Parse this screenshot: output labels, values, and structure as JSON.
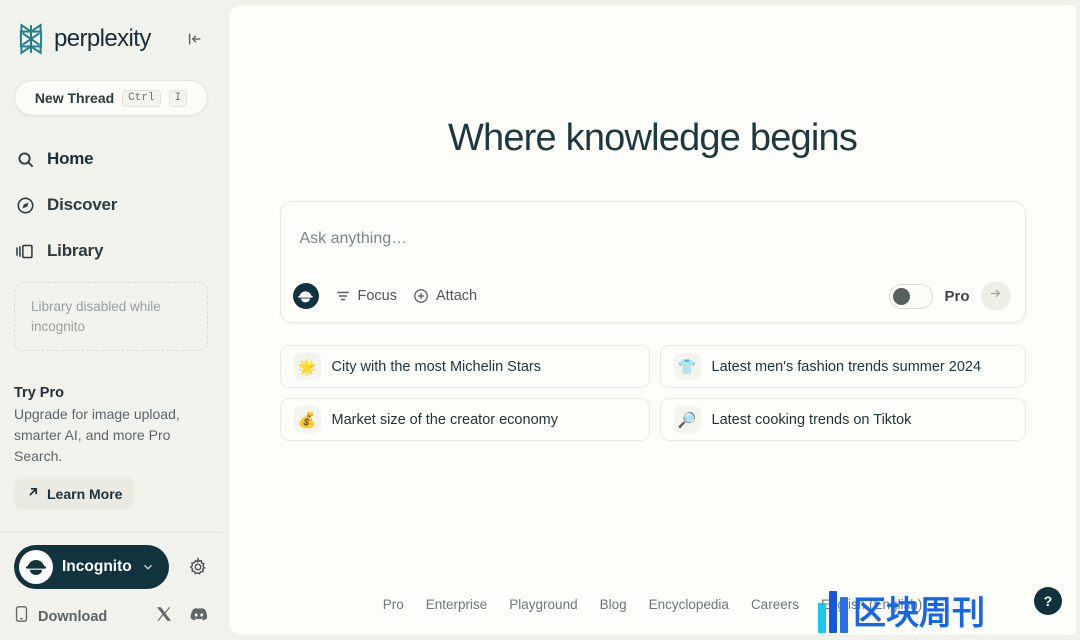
{
  "sidebar": {
    "brand": "perplexity",
    "collapse_icon": "collapse-left-icon",
    "new_thread": {
      "label": "New Thread",
      "key_mod": "Ctrl",
      "key_letter": "I"
    },
    "nav": [
      {
        "label": "Home",
        "icon": "search-icon",
        "active": true
      },
      {
        "label": "Discover",
        "icon": "compass-icon",
        "active": false
      },
      {
        "label": "Library",
        "icon": "library-icon",
        "active": false
      }
    ],
    "library_disabled_note": "Library disabled while incognito",
    "try_pro": {
      "title": "Try Pro",
      "body": "Upgrade for image upload, smarter AI, and more Pro Search.",
      "cta": "Learn More",
      "cta_icon": "arrow-up-right-icon"
    },
    "account": {
      "name": "Incognito",
      "avatar_icon": "incognito-hat-icon",
      "chevron_icon": "chevron-down-icon",
      "settings_icon": "gear-icon"
    },
    "download": {
      "label": "Download",
      "icon": "phone-icon"
    },
    "socials": [
      {
        "name": "x-twitter-icon"
      },
      {
        "name": "discord-icon"
      }
    ]
  },
  "main": {
    "hero": "Where knowledge begins",
    "ask": {
      "placeholder": "Ask anything…",
      "avatar_icon": "incognito-hat-icon",
      "focus_label": "Focus",
      "focus_icon": "filter-lines-icon",
      "attach_label": "Attach",
      "attach_icon": "plus-circle-icon",
      "pro_label": "Pro",
      "pro_enabled": false,
      "submit_icon": "arrow-right-icon"
    },
    "suggestions": [
      {
        "emoji": "🌟",
        "text": "City with the most Michelin Stars"
      },
      {
        "emoji": "👕",
        "text": "Latest men's fashion trends summer 2024"
      },
      {
        "emoji": "💰",
        "text": "Market size of the creator economy"
      },
      {
        "emoji": "🔎",
        "text": "Latest cooking trends on Tiktok"
      }
    ],
    "footer_links": [
      "Pro",
      "Enterprise",
      "Playground",
      "Blog",
      "Encyclopedia",
      "Careers",
      "English (English)"
    ],
    "help_label": "?"
  },
  "watermark": {
    "text": "区块周刊",
    "color": "#1667E8"
  },
  "colors": {
    "sidebar_bg": "#F2F2EC",
    "main_bg": "#FDFDFA",
    "brand_teal": "#20808D",
    "ink": "#1F3136",
    "dark_pill": "#11333D"
  }
}
